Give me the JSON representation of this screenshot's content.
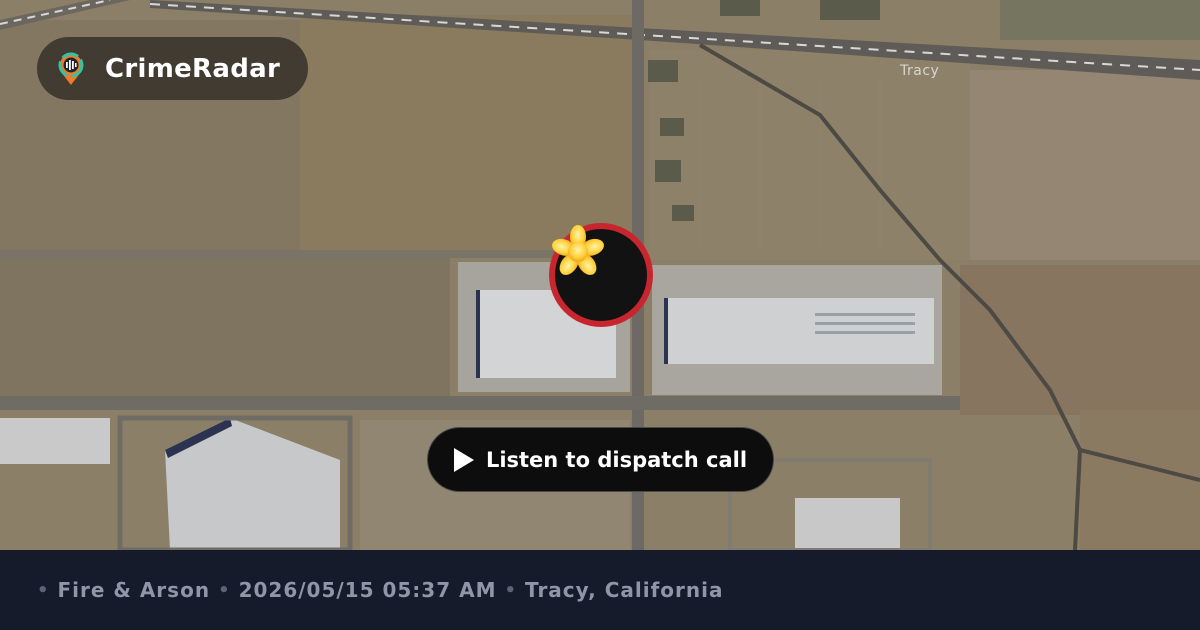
{
  "brand": {
    "name": "CrimeRadar",
    "logo_icon": "radar-pin-icon"
  },
  "map": {
    "place_label": "Tracy",
    "marker_icon": "fire-asterisk-icon",
    "marker_ring_color": "#c8262f"
  },
  "action": {
    "label": "Listen to dispatch call",
    "icon": "play-icon"
  },
  "footer": {
    "category": "Fire & Arson",
    "datetime": "2026/05/15 05:37 AM",
    "location": "Tracy, California"
  }
}
